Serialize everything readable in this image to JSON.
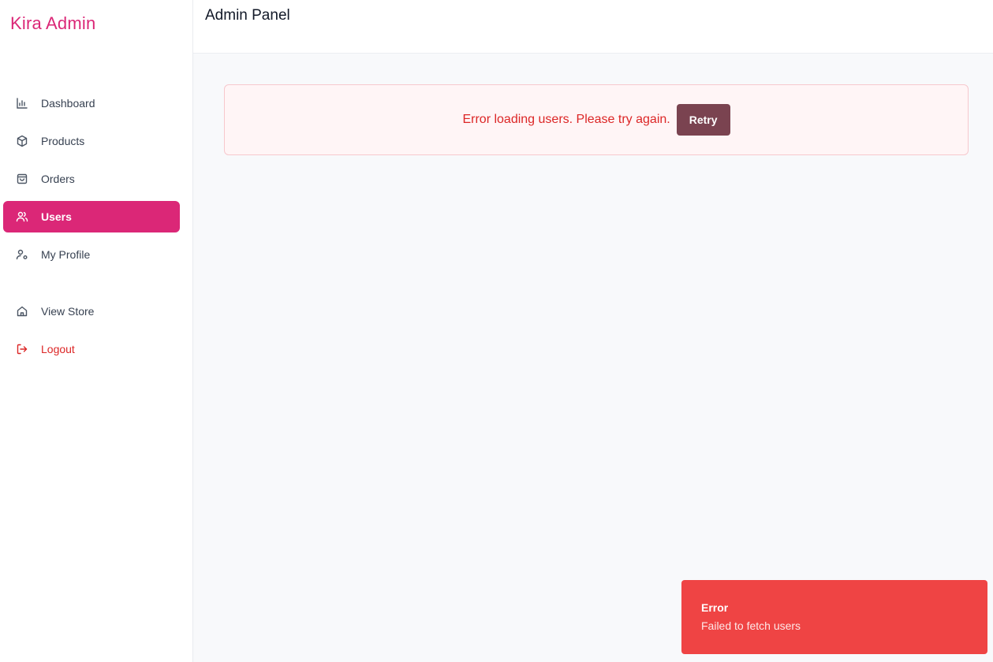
{
  "brand": "Kira Admin",
  "header": {
    "title": "Admin Panel"
  },
  "sidebar": {
    "items": [
      {
        "label": "Dashboard",
        "icon": "bar-chart-icon",
        "active": false
      },
      {
        "label": "Products",
        "icon": "package-icon",
        "active": false
      },
      {
        "label": "Orders",
        "icon": "shopping-bag-icon",
        "active": false
      },
      {
        "label": "Users",
        "icon": "users-icon",
        "active": true
      },
      {
        "label": "My Profile",
        "icon": "user-settings-icon",
        "active": false
      }
    ],
    "secondary": [
      {
        "label": "View Store",
        "icon": "home-icon"
      },
      {
        "label": "Logout",
        "icon": "logout-icon"
      }
    ]
  },
  "main": {
    "error": {
      "message": "Error loading users. Please try again.",
      "retry_label": "Retry"
    }
  },
  "toast": {
    "title": "Error",
    "message": "Failed to fetch users"
  },
  "colors": {
    "brand": "#db2777",
    "active_nav": "#db2777",
    "error_text": "#dc2626",
    "retry_button": "#7a4350",
    "toast_bg": "#ef4444"
  }
}
